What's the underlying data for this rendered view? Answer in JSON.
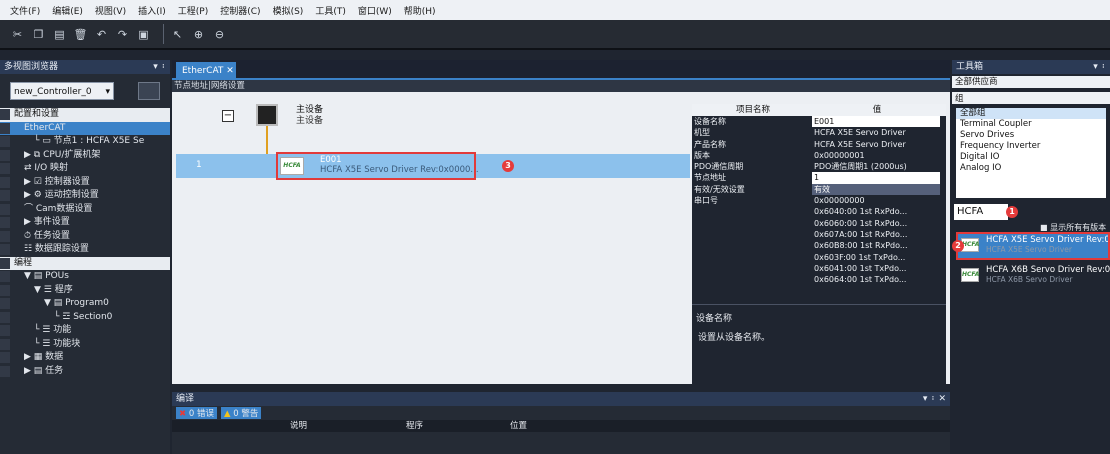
{
  "menu": [
    "文件(F)",
    "编辑(E)",
    "视图(V)",
    "插入(I)",
    "工程(P)",
    "控制器(C)",
    "模拟(S)",
    "工具(T)",
    "窗口(W)",
    "帮助(H)"
  ],
  "toolbar_icons": [
    "cut-icon",
    "copy-icon",
    "paste-icon",
    "delete-icon",
    "undo-icon",
    "redo-icon",
    "save-icon",
    "pointer-icon",
    "zoom-in-icon",
    "zoom-out-icon"
  ],
  "left": {
    "title": "多视图浏览器",
    "pin": "▾ ᛬",
    "controller": "new_Controller_0",
    "items": [
      {
        "label": "配置和设置",
        "depth": 0,
        "type": "hdr"
      },
      {
        "label": "EtherCAT",
        "depth": 1,
        "type": "sel"
      },
      {
        "label": "└ ▭ 节点1 : HCFA X5E Se",
        "depth": 2,
        "type": "n"
      },
      {
        "label": "▶ ⧉ CPU/扩展机架",
        "depth": 1,
        "type": "n"
      },
      {
        "label": "⇄ I/O 映射",
        "depth": 1,
        "type": "n"
      },
      {
        "label": "▶ ☑ 控制器设置",
        "depth": 1,
        "type": "n"
      },
      {
        "label": "▶ ⚙ 运动控制设置",
        "depth": 1,
        "type": "n"
      },
      {
        "label": "⌒ Cam数据设置",
        "depth": 1,
        "type": "n"
      },
      {
        "label": "▶ 事件设置",
        "depth": 1,
        "type": "n"
      },
      {
        "label": "⏱ 任务设置",
        "depth": 1,
        "type": "n"
      },
      {
        "label": "☷ 数据跟踪设置",
        "depth": 1,
        "type": "n"
      },
      {
        "label": "编程",
        "depth": 0,
        "type": "hdr"
      },
      {
        "label": "▼ ▤ POUs",
        "depth": 1,
        "type": "n"
      },
      {
        "label": "▼ ☰ 程序",
        "depth": 2,
        "type": "n"
      },
      {
        "label": "▼ ▤ Program0",
        "depth": 3,
        "type": "n"
      },
      {
        "label": "└ ☲ Section0",
        "depth": 4,
        "type": "n"
      },
      {
        "label": "└ ☰ 功能",
        "depth": 2,
        "type": "n"
      },
      {
        "label": "└ ☰ 功能块",
        "depth": 2,
        "type": "n"
      },
      {
        "label": "▶ ▦ 数据",
        "depth": 1,
        "type": "n"
      },
      {
        "label": "▶ ▤ 任务",
        "depth": 1,
        "type": "n"
      }
    ]
  },
  "center": {
    "tab": "EtherCAT",
    "subheader": "节点地址|网络设置",
    "master1": "主设备",
    "master2": "主设备",
    "node_no": "1",
    "node_id": "E001",
    "node_desc": "HCFA X5E Servo Driver Rev:0x0000...",
    "logo": "HCFA"
  },
  "props": {
    "h_name": "项目名称",
    "h_val": "值",
    "rows": [
      {
        "k": "设备名称",
        "v": "E001",
        "style": "inp"
      },
      {
        "k": "机型",
        "v": "HCFA X5E Servo Driver",
        "style": ""
      },
      {
        "k": "产品名称",
        "v": "HCFA X5E Servo Driver",
        "style": ""
      },
      {
        "k": "版本",
        "v": "0x00000001",
        "style": ""
      },
      {
        "k": "PDO通信周期",
        "v": "PDO通信周期1 (2000us)",
        "style": ""
      },
      {
        "k": "节点地址",
        "v": "1",
        "style": "inp"
      },
      {
        "k": "有效/无效设置",
        "v": "有效",
        "style": "dd"
      },
      {
        "k": "串口号",
        "v": "0x00000000",
        "style": ""
      },
      {
        "k": "",
        "v": "0x6040:00 1st RxPdo...",
        "style": ""
      },
      {
        "k": "",
        "v": "0x6060:00 1st RxPdo...",
        "style": ""
      },
      {
        "k": "",
        "v": "0x607A:00 1st RxPdo...",
        "style": ""
      },
      {
        "k": "",
        "v": "0x60B8:00 1st RxPdo...",
        "style": ""
      },
      {
        "k": "",
        "v": "0x603F:00 1st TxPdo...",
        "style": ""
      },
      {
        "k": "",
        "v": "0x6041:00 1st TxPdo...",
        "style": ""
      },
      {
        "k": "",
        "v": "0x6064:00 1st TxPdo...",
        "style": ""
      }
    ],
    "desc_title": "设备名称",
    "desc_text": "设置从设备名称。"
  },
  "bottom": {
    "title": "编译",
    "errors": "0 错误",
    "warnings": "0 警告",
    "cols": [
      "说明",
      "程序",
      "位置"
    ]
  },
  "right": {
    "title": "工具箱",
    "vendor": "全部供应商",
    "group_label": "组",
    "groups": [
      "全部组",
      "Terminal Coupler",
      "Servo Drives",
      "Frequency Inverter",
      "Digital IO",
      "Analog IO"
    ],
    "search": "HCFA",
    "show_all": "显示所有有版本",
    "results": [
      {
        "name": "HCFA X5E Servo Driver Rev:0",
        "sub": "HCFA X5E Servo Driver"
      },
      {
        "name": "HCFA X6B Servo Driver Rev:0",
        "sub": "HCFA X6B Servo Driver"
      }
    ]
  },
  "callouts": [
    "1",
    "2",
    "3"
  ],
  "colors": {
    "accent": "#3b82c8",
    "callout": "#e53b3b",
    "selected_row": "#8cc1ec"
  }
}
